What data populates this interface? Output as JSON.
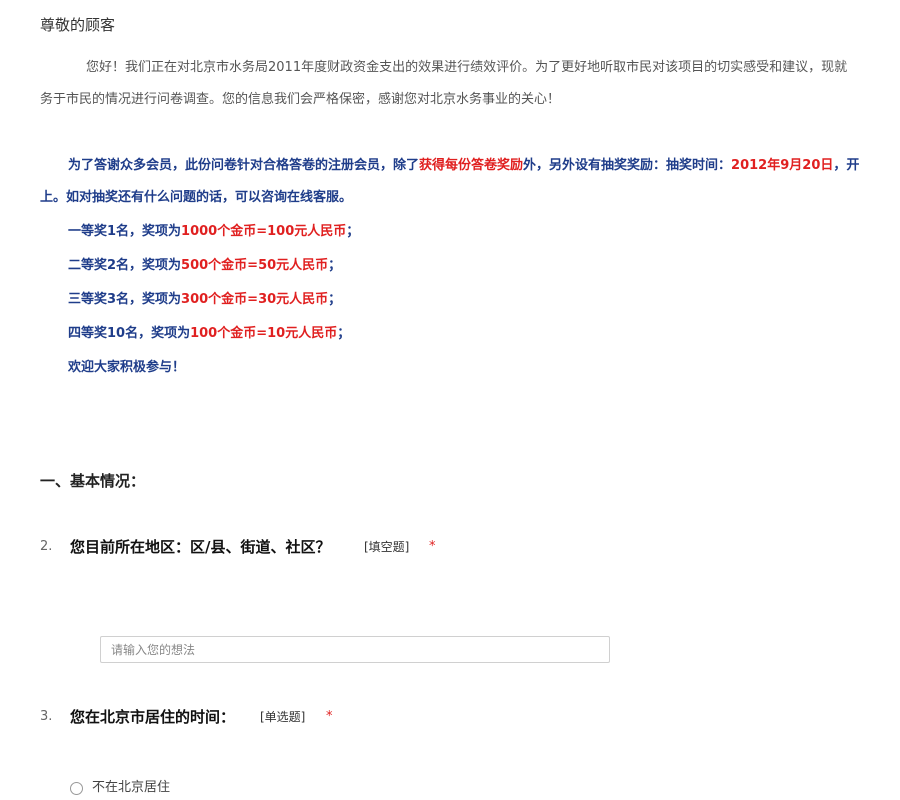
{
  "intro": {
    "greeting": "尊敬的顾客",
    "paragraph_line1": "您好！我们正在对北京市水务局2011年度财政资金支出的效果进行绩效评价。为了更好地听取市民对该项目的切实感受和建议，现就",
    "paragraph_line2": "务于市民的情况进行问卷调查。您的信息我们会严格保密，感谢您对北京水务事业的关心！"
  },
  "notice": {
    "line1_a": "为了答谢众多会员，此份问卷针对合格答卷的注册会员，除了",
    "line1_hl1": "获得每份答卷奖励",
    "line1_b": "外，另外设有抽奖奖励：抽奖时间：",
    "line1_hl2": "2012年9月20日",
    "line1_c": "，开",
    "line2": "上。如对抽奖还有什么问题的话，可以咨询在线客服。",
    "prizes": [
      {
        "label": "一等奖1名，奖项为",
        "value": "1000个金币=100元人民币",
        "end": "；"
      },
      {
        "label": "二等奖2名，奖项为",
        "value": "500个金币=50元人民币",
        "end": "；"
      },
      {
        "label": "三等奖3名，奖项为",
        "value": "300个金币=30元人民币",
        "end": "；"
      },
      {
        "label": "四等奖10名，奖项为",
        "value": "100个金币=10元人民币",
        "end": "；"
      }
    ],
    "closing": "欢迎大家积极参与！"
  },
  "section": {
    "title": "一、基本情况："
  },
  "questions": [
    {
      "number": "2.",
      "title": "您目前所在地区：区/县、街道、社区？",
      "type": "[填空题]",
      "required_mark": "*",
      "input_value": "",
      "placeholder": "请输入您的想法"
    },
    {
      "number": "3.",
      "title": "您在北京市居住的时间：",
      "type": "[单选题]",
      "required_mark": "*",
      "options": [
        "不在北京居住"
      ]
    }
  ],
  "colors": {
    "notice_blue": "#1f3d8a",
    "highlight_red": "#e02020",
    "required_red": "#e02020"
  }
}
